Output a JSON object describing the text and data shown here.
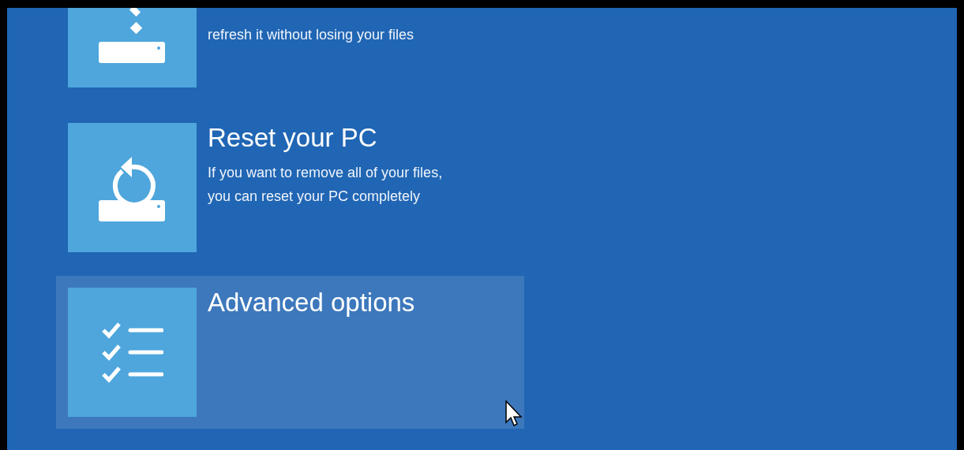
{
  "options": [
    {
      "kind": "clipped",
      "description": [
        "refresh it without losing your files"
      ],
      "selected": false
    },
    {
      "kind": "full",
      "title": "Reset your PC",
      "description": [
        "If you want to remove all of your files,",
        "you can reset your PC completely"
      ],
      "selected": false
    },
    {
      "kind": "full",
      "title": "Advanced options",
      "selected": true
    }
  ]
}
